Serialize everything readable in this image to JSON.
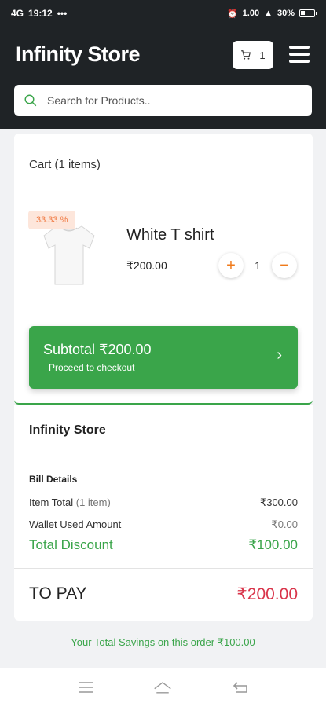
{
  "status_bar": {
    "network": "4G",
    "time": "19:12",
    "dots": "•••",
    "speed": "1.00",
    "battery": "30%"
  },
  "header": {
    "title": "Infinity Store",
    "cart_count": "1",
    "search_placeholder": "Search for Products.."
  },
  "cart": {
    "heading": "Cart (1 items)",
    "items": [
      {
        "discount_badge": "33.33 %",
        "name": "White T shirt",
        "price": "₹200.00",
        "quantity": "1",
        "image_icon": "tshirt-image"
      }
    ],
    "increment_symbol": "+",
    "decrement_symbol": "−"
  },
  "subtotal": {
    "label": "Subtotal ₹200.00",
    "sub_label": "Proceed to checkout",
    "arrow": "›"
  },
  "bill": {
    "store_name": "Infinity Store",
    "details_heading": "Bill Details",
    "item_total_label": "Item Total",
    "item_total_count": "(1 item)",
    "item_total_value": "₹300.00",
    "wallet_label": "Wallet Used Amount",
    "wallet_value": "₹0.00",
    "discount_label": "Total Discount",
    "discount_value": "₹100.00",
    "to_pay_label": "TO PAY",
    "to_pay_value": "₹200.00"
  },
  "savings_text": "Your Total Savings on this order ₹100.00",
  "colors": {
    "header_bg": "#1f2326",
    "accent_green": "#3aa54a",
    "accent_orange": "#f07a1a",
    "pay_red": "#d9344a"
  },
  "nav_icons": [
    "menu-icon",
    "home-icon",
    "back-icon"
  ]
}
